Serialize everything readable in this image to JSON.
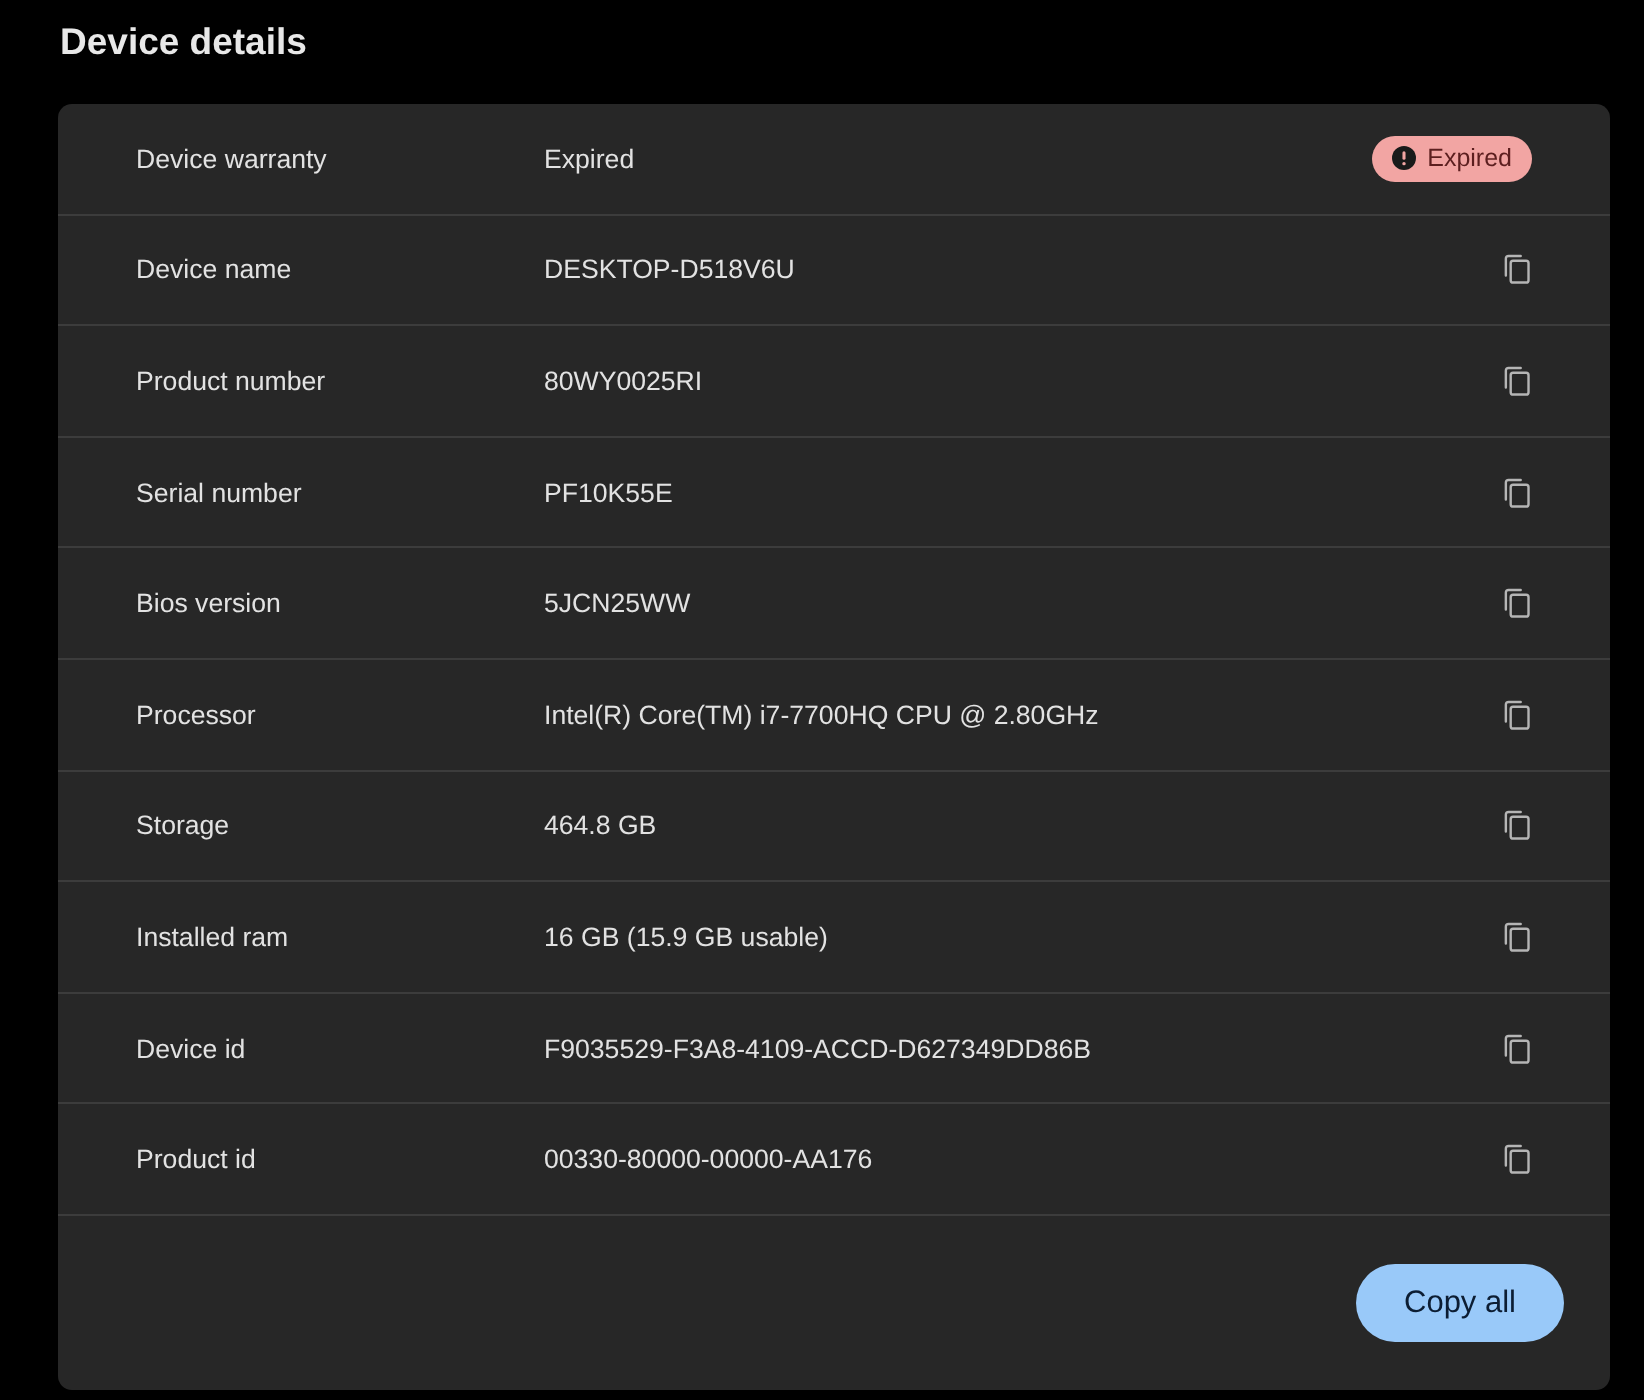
{
  "title": "Device details",
  "rows": [
    {
      "kind": "badge",
      "label": "Device warranty",
      "value": "Expired",
      "badge": {
        "kind": "error",
        "text": "Expired"
      }
    },
    {
      "kind": "copy",
      "label": "Device name",
      "value": "DESKTOP-D518V6U"
    },
    {
      "kind": "copy",
      "label": "Product number",
      "value": "80WY0025RI"
    },
    {
      "kind": "copy",
      "label": "Serial number",
      "value": "PF10K55E"
    },
    {
      "kind": "copy",
      "label": "Bios version",
      "value": "5JCN25WW"
    },
    {
      "kind": "copy",
      "label": "Processor",
      "value": "Intel(R) Core(TM) i7-7700HQ CPU @ 2.80GHz"
    },
    {
      "kind": "copy",
      "label": "Storage",
      "value": "464.8 GB"
    },
    {
      "kind": "copy",
      "label": "Installed ram",
      "value": "16 GB (15.9 GB usable)"
    },
    {
      "kind": "copy",
      "label": "Device id",
      "value": "F9035529-F3A8-4109-ACCD-D627349DD86B"
    },
    {
      "kind": "copy",
      "label": "Product id",
      "value": "00330-80000-00000-AA176"
    }
  ],
  "footer": {
    "button": "Copy all"
  }
}
